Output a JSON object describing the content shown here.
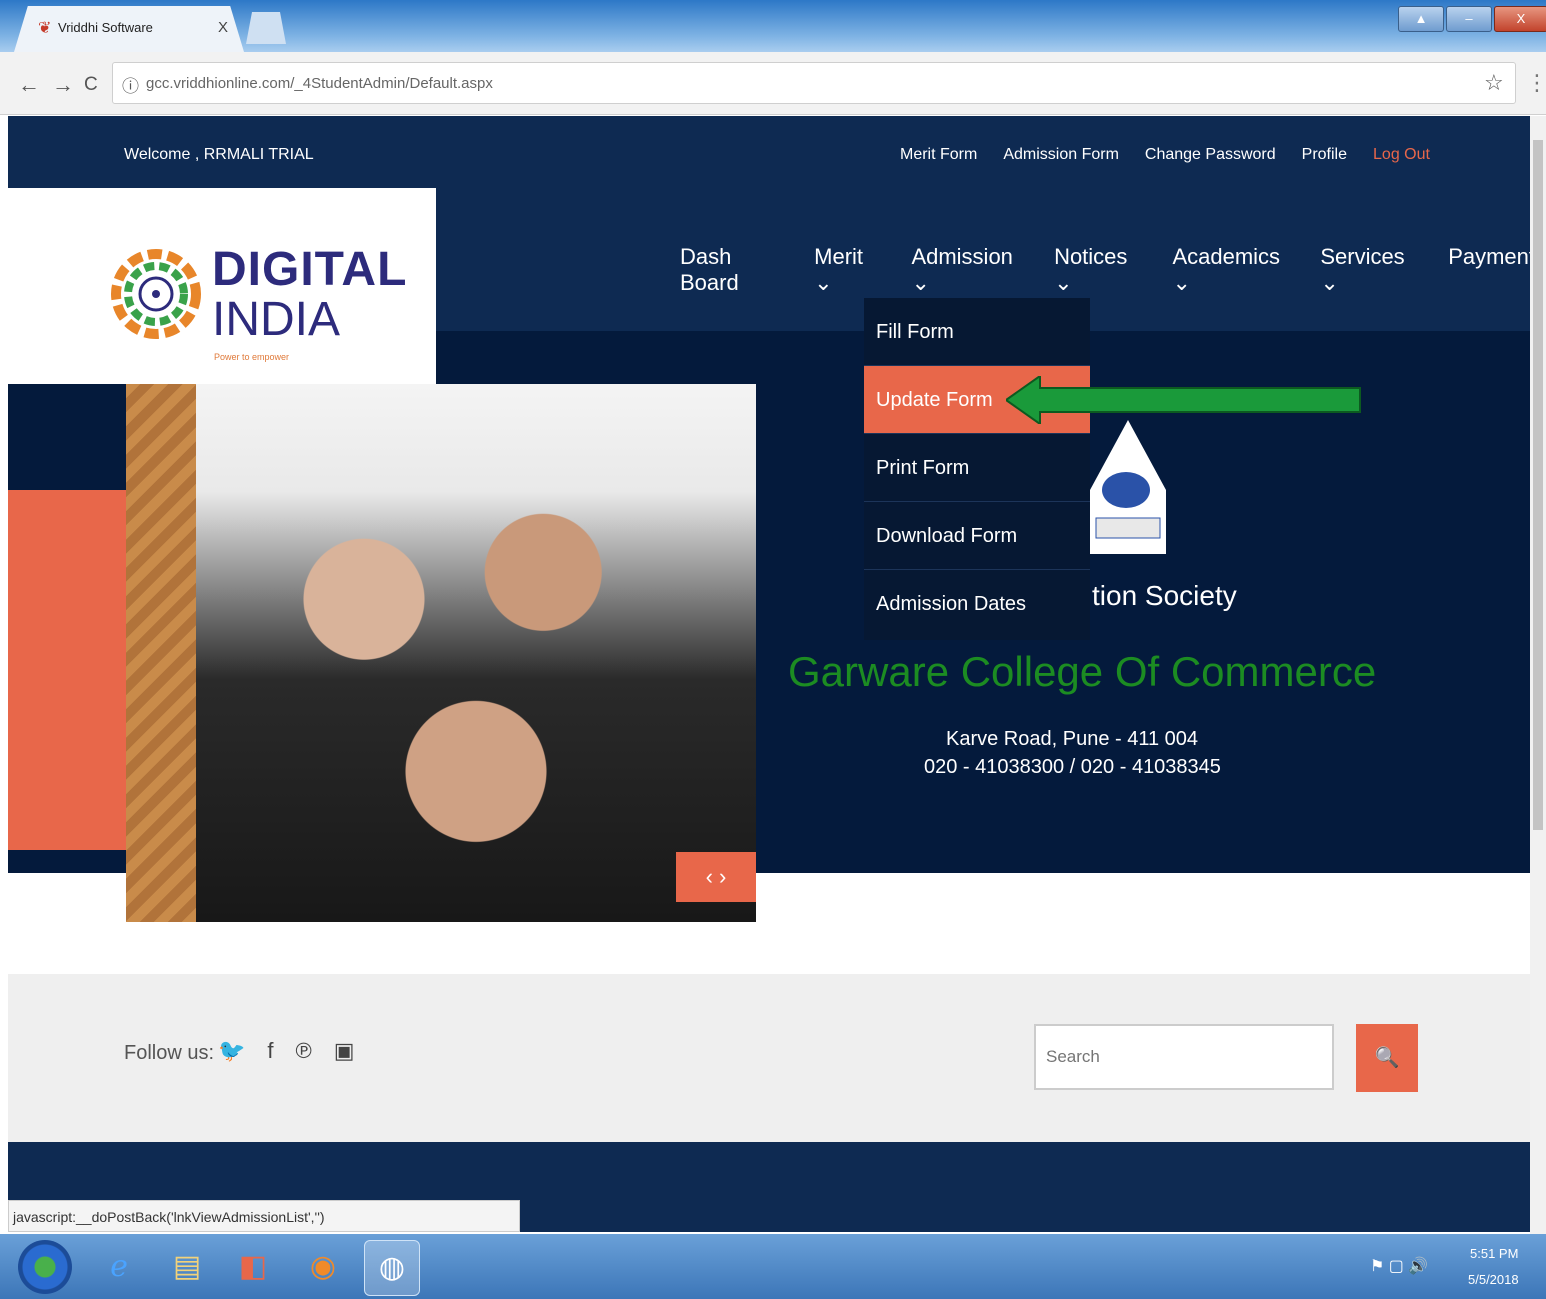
{
  "browser": {
    "tab_title": "Vriddhi Software",
    "tab_close": "X",
    "url": "gcc.vriddhionline.com/_4StudentAdmin/Default.aspx",
    "url_info_icon": "ⓘ",
    "back": "←",
    "forward": "→",
    "reload": "C",
    "star": "☆",
    "menu": "⋮",
    "window_buttons": [
      "▲",
      "–",
      "▫",
      "X"
    ]
  },
  "page": {
    "welcome": "Welcome , RRMALI TRIAL",
    "top_links": [
      "Merit Form",
      "Admission Form",
      "Change Password",
      "Profile",
      "Log Out"
    ],
    "logo": {
      "digital": "DIGITAL",
      "india": "INDIA",
      "tagline": "Power to empower"
    },
    "main_nav": [
      "Dash Board",
      "Merit ⌄",
      "Admission ⌄",
      "Notices ⌄",
      "Academics ⌄",
      "Services ⌄",
      "Payments"
    ],
    "dropdown": [
      "Fill Form",
      "Update Form",
      "Print Form",
      "Download Form",
      "Admission Dates"
    ],
    "dropdown_active": "Update Form",
    "society_fragment": "tion Society",
    "college_name": "Garware College Of Commerce",
    "address": "Karve Road, Pune - 411 004",
    "phones": "020 - 41038300 / 020 - 41038345",
    "slider_controls": "‹   ›",
    "follow_label": "Follow us:",
    "social_icons": [
      "twitter-icon",
      "facebook-icon",
      "pinterest-icon",
      "youtube-icon"
    ],
    "social_glyphs": [
      "🐦",
      "f",
      "℗",
      "▣"
    ],
    "search_placeholder": "Search",
    "search_glyph": "🔍",
    "status_text": "javascript:__doPostBack('lnkViewAdmissionList','')"
  },
  "taskbar": {
    "clock_time": "5:51 PM",
    "clock_date": "5/5/2018",
    "tray": "⚑ ▢ 🔊"
  },
  "colors": {
    "navy": "#0e2a52",
    "dark_navy": "#041a3c",
    "accent_orange": "#e8674a",
    "college_green": "#1c8c22",
    "arrow_green": "#1a9a3a"
  }
}
